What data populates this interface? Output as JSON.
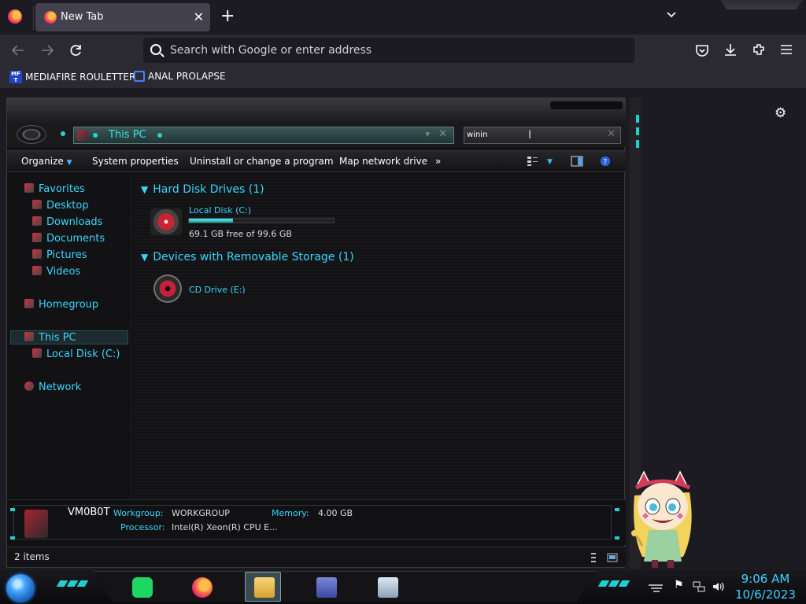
{
  "browser": {
    "tab_title": "New Tab",
    "tab_close": "✕",
    "new_tab": "+",
    "url_placeholder": "Search with Google or enter address",
    "bookmarks": [
      {
        "label": "MEDIAFIRE ROULETTER",
        "icon": "mediafire-icon",
        "icon_text": "MF T"
      },
      {
        "label": "ANAL PROLAPSE",
        "icon": "sigma-icon"
      }
    ]
  },
  "explorer": {
    "address_crumb": "This PC",
    "search_value": "winin",
    "commands": [
      "Organize",
      "System properties",
      "Uninstall or change a program",
      "Map network drive",
      "»"
    ],
    "nav": {
      "favorites": "Favorites",
      "favorite_items": [
        "Desktop",
        "Downloads",
        "Documents",
        "Pictures",
        "Videos"
      ],
      "homegroup": "Homegroup",
      "this_pc": "This PC",
      "this_pc_items": [
        "Local Disk (C:)"
      ],
      "network": "Network"
    },
    "groups": [
      {
        "title": "Hard Disk Drives (1)"
      },
      {
        "title": "Devices with Removable Storage (1)"
      }
    ],
    "drives": [
      {
        "name": "Local Disk (C:)",
        "free_text": "69.1 GB free of 99.6 GB",
        "used_fraction": 0.306
      },
      {
        "name": "CD Drive (E:)"
      }
    ],
    "details": {
      "computer_name": "VM0B0T",
      "workgroup_label": "Workgroup:",
      "workgroup_value": "WORKGROUP",
      "memory_label": "Memory:",
      "memory_value": "4.00 GB",
      "processor_label": "Processor:",
      "processor_value": "Intel(R) Xeon(R) CPU E..."
    },
    "status": "2 items"
  },
  "taskbar": {
    "apps": [
      "spotify",
      "firefox",
      "file-explorer",
      "control-panel",
      "task-manager"
    ],
    "time": "9:06 AM",
    "date": "10/6/2023"
  },
  "colors": {
    "accent_cyan": "#36d6ff",
    "browser_bg": "#1c1b22",
    "toolbar_bg": "#2b2a33"
  }
}
